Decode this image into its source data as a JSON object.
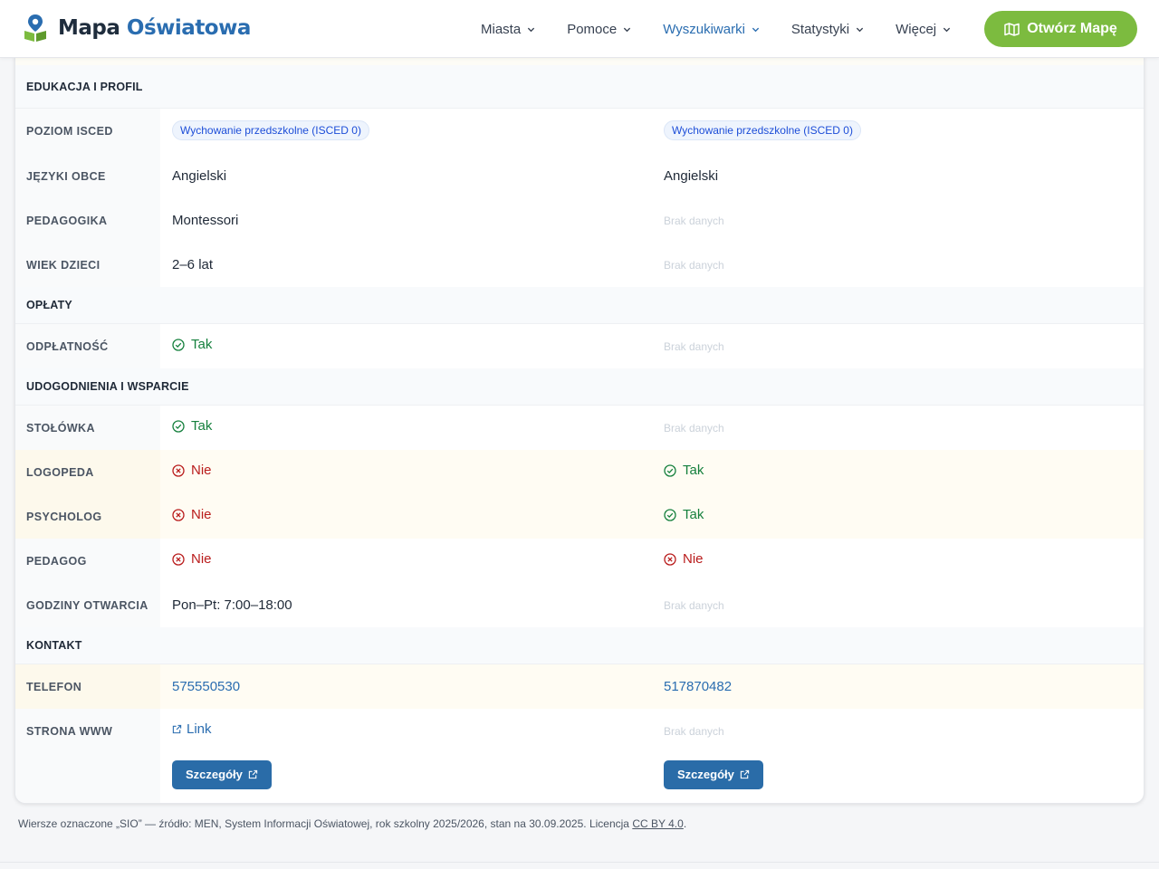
{
  "brand": {
    "part1": "Mapa",
    "part2": "Oświatowa"
  },
  "nav": [
    {
      "label": "Miasta",
      "active": false
    },
    {
      "label": "Pomoce",
      "active": false
    },
    {
      "label": "Wyszukiwarki",
      "active": true
    },
    {
      "label": "Statystyki",
      "active": false
    },
    {
      "label": "Więcej",
      "active": false
    }
  ],
  "cta_label": "Otwórz Mapę",
  "sections": {
    "education": "EDUKACJA I PROFIL",
    "fees": "OPŁATY",
    "facilities": "UDOGODNIENIA I WSPARCIE",
    "contact": "KONTAKT"
  },
  "rows": {
    "isced": {
      "label": "POZIOM ISCED",
      "c1": "Wychowanie przedszkolne (ISCED 0)",
      "c2": "Wychowanie przedszkolne (ISCED 0)"
    },
    "languages": {
      "label": "JĘZYKI OBCE",
      "c1": "Angielski",
      "c2": "Angielski"
    },
    "pedagogy": {
      "label": "PEDAGOGIKA",
      "c1": "Montessori",
      "c2": "Brak danych"
    },
    "age": {
      "label": "WIEK DZIECI",
      "c1": "2–6 lat",
      "c2": "Brak danych"
    },
    "paid": {
      "label": "ODPŁATNOŚĆ",
      "c1": "Tak",
      "c2": "Brak danych"
    },
    "canteen": {
      "label": "STOŁÓWKA",
      "c1": "Tak",
      "c2": "Brak danych"
    },
    "speech": {
      "label": "LOGOPEDA",
      "c1": "Nie",
      "c2": "Tak"
    },
    "psych": {
      "label": "PSYCHOLOG",
      "c1": "Nie",
      "c2": "Tak"
    },
    "pedagog": {
      "label": "PEDAGOG",
      "c1": "Nie",
      "c2": "Nie"
    },
    "hours": {
      "label": "GODZINY OTWARCIA",
      "c1": "Pon–Pt: 7:00–18:00",
      "c2": "Brak danych"
    },
    "phone": {
      "label": "TELEFON",
      "c1": "575550530",
      "c2": "517870482"
    },
    "www": {
      "label": "STRONA WWW",
      "c1": "Link",
      "c2": "Brak danych"
    }
  },
  "details_label": "Szczegóły",
  "footer": {
    "text": "Wiersze oznaczone „SIO” — źródło: MEN, System Informacji Oświatowej, rok szkolny 2025/2026, stan na 30.09.2025. Licencja",
    "license": "CC BY 4.0",
    "end": "."
  },
  "colors": {
    "brand_blue": "#2a6db0",
    "cta_green": "#7cbb3f",
    "yes": "#15803d",
    "no": "#b91c1c"
  }
}
